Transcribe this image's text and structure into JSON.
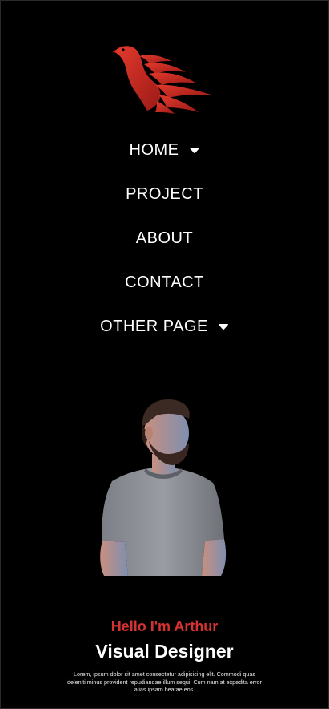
{
  "nav": {
    "items": [
      {
        "label": "HOME",
        "has_dropdown": true
      },
      {
        "label": "PROJECT",
        "has_dropdown": false
      },
      {
        "label": "ABOUT",
        "has_dropdown": false
      },
      {
        "label": "CONTACT",
        "has_dropdown": false
      },
      {
        "label": "OTHER PAGE",
        "has_dropdown": true
      }
    ]
  },
  "hero": {
    "greeting": "Hello I'm Arthur",
    "title": "Visual Designer",
    "description": "Lorem, ipsum dolor sit amet consectetur adipisicing elit. Commodi quas deleniti minus provident repudiandae illum sequi. Cum nam at expedita error alias ipsam beatae eos."
  },
  "icons": {
    "logo": "phoenix-logo-icon",
    "dropdown": "caret-down-icon"
  },
  "colors": {
    "background": "#000000",
    "accent": "#d63232",
    "text": "#ffffff"
  }
}
